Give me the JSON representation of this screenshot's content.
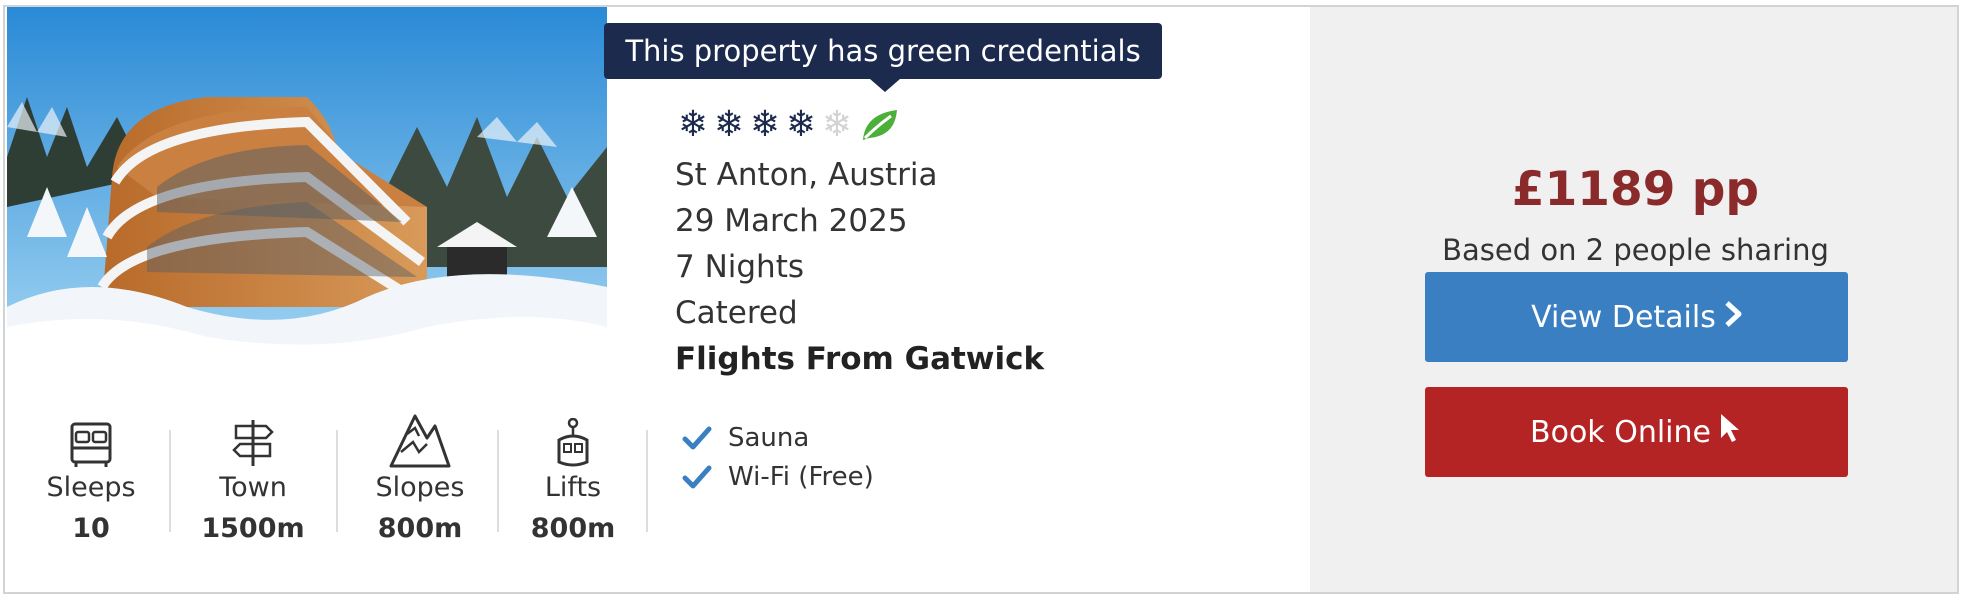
{
  "tooltip": {
    "text": "This property has green credentials"
  },
  "rating": {
    "filled": 4,
    "total": 5,
    "green_badge_icon": "leaf-icon"
  },
  "details": {
    "location": "St Anton, Austria",
    "date": "29 March 2025",
    "nights": "7 Nights",
    "board": "Catered",
    "flights": "Flights From Gatwick"
  },
  "features": [
    {
      "icon": "bed-icon",
      "label": "Sleeps",
      "value": "10"
    },
    {
      "icon": "signpost-icon",
      "label": "Town",
      "value": "1500m"
    },
    {
      "icon": "mountain-icon",
      "label": "Slopes",
      "value": "800m"
    },
    {
      "icon": "gondola-icon",
      "label": "Lifts",
      "value": "800m"
    }
  ],
  "amenities": [
    "Sauna",
    "Wi-Fi (Free)"
  ],
  "pricing": {
    "price": "£1189 pp",
    "note": "Based on 2 people sharing"
  },
  "buttons": {
    "view_details": "View Details",
    "book_online": "Book Online"
  },
  "colors": {
    "navy": "#1c2a4e",
    "price_red": "#8b2a2a",
    "view_blue": "#3a7fc2",
    "book_red": "#b52424",
    "check_blue": "#3a7fc2",
    "leaf_green": "#4caf3a"
  }
}
